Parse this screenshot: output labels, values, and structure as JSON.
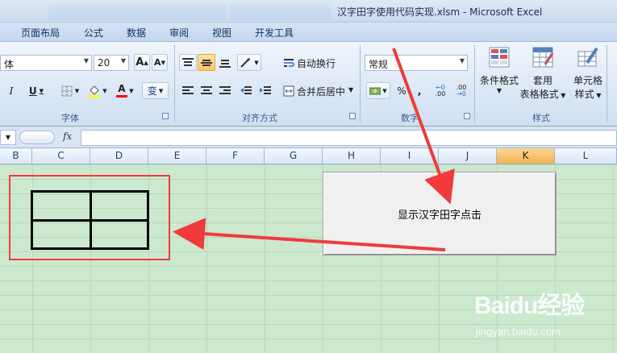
{
  "window": {
    "title": "汉字田字使用代码实现.xlsm - Microsoft Excel"
  },
  "ribbon_tabs": [
    "页面布局",
    "公式",
    "数据",
    "审阅",
    "视图",
    "开发工具"
  ],
  "font_group": {
    "font_name": "体",
    "font_size": "20",
    "grow_label": "A",
    "shrink_label": "A",
    "italic_label": "I",
    "underline_label": "U",
    "phonetic_label": "变",
    "group_label": "字体"
  },
  "alignment_group": {
    "wrap_label": "自动换行",
    "merge_label": "合并后居中",
    "group_label": "对齐方式"
  },
  "number_group": {
    "format_value": "常规",
    "percent_label": "%",
    "comma_label": ",",
    "inc_decimal_label": ".00",
    "dec_decimal_label": ".00",
    "group_label": "数字"
  },
  "styles_group": {
    "conditional_label": "条件格式",
    "table_label_1": "套用",
    "table_label_2": "表格格式",
    "cell_label_1": "单元格",
    "cell_label_2": "样式",
    "group_label": "样式"
  },
  "formula_bar": {
    "fx_label": "fx",
    "value": ""
  },
  "columns": [
    "B",
    "C",
    "D",
    "E",
    "F",
    "G",
    "H",
    "I",
    "J",
    "K",
    "L"
  ],
  "selected_column": "K",
  "sheet_button": {
    "label": "显示汉字田字点击"
  },
  "colors": {
    "sheet_bg": "#cce8cf",
    "highlight_box": "#ef3b3b",
    "arrow": "#ef3b3b",
    "selected_col": "#f4b24e"
  },
  "watermark": {
    "logo": "Baidu经验",
    "url": "jingyan.baidu.com"
  }
}
